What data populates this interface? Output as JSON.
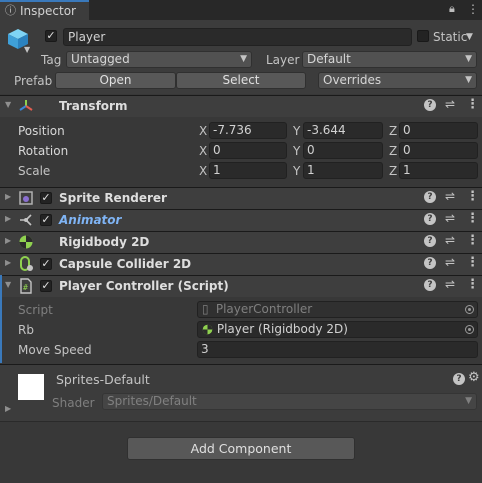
{
  "tab": {
    "icon": "info-icon",
    "label": "Inspector"
  },
  "header": {
    "object_icon": "cube-icon",
    "active_checked": true,
    "name": "Player",
    "static_label": "Static",
    "tag_label": "Tag",
    "tag_value": "Untagged",
    "layer_label": "Layer",
    "layer_value": "Default",
    "prefab_label": "Prefab",
    "open_button": "Open",
    "select_button": "Select",
    "overrides_value": "Overrides"
  },
  "transform": {
    "title": "Transform",
    "rows": [
      {
        "label": "Position",
        "x": "-7.736",
        "y": "-3.644",
        "z": "0"
      },
      {
        "label": "Rotation",
        "x": "0",
        "y": "0",
        "z": "0"
      },
      {
        "label": "Scale",
        "x": "1",
        "y": "1",
        "z": "1"
      }
    ],
    "axis_labels": {
      "x": "X",
      "y": "Y",
      "z": "Z"
    }
  },
  "components": [
    {
      "title": "Sprite Renderer",
      "icon": "sprite-renderer-icon",
      "checked": true
    },
    {
      "title": "Animator",
      "icon": "animator-icon",
      "checked": true,
      "highlight": "#7fb4f5"
    },
    {
      "title": "Rigidbody 2D",
      "icon": "rigidbody2d-icon"
    },
    {
      "title": "Capsule Collider 2D",
      "icon": "capsule-collider-icon",
      "checked": true
    },
    {
      "title": "Player Controller (Script)",
      "icon": "script-icon",
      "checked": true
    }
  ],
  "script_fields": {
    "script_label": "Script",
    "script_value": "PlayerController",
    "rb_label": "Rb",
    "rb_value": "Player (Rigidbody 2D)",
    "speed_label": "Move Speed",
    "speed_value": "3"
  },
  "material": {
    "name": "Sprites-Default",
    "shader_label": "Shader",
    "shader_value": "Sprites/Default"
  },
  "add_component": "Add Component",
  "colors": {
    "accent": "#3a79bb",
    "background": "#383838",
    "header": "#3e3e3e"
  }
}
